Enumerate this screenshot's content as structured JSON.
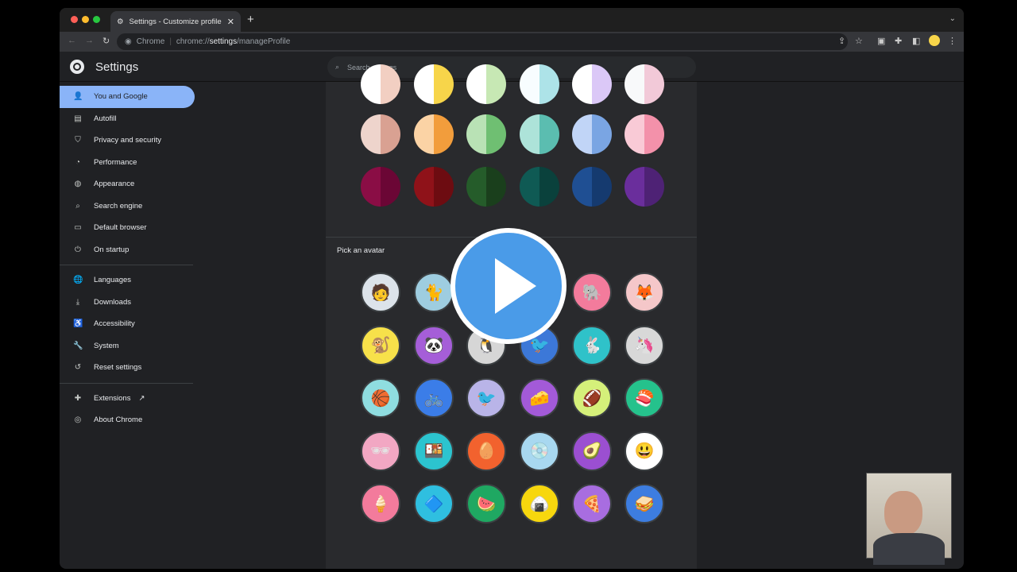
{
  "browser": {
    "tab_title": "Settings - Customize profile",
    "omnibox_site": "Chrome",
    "url_prefix": "chrome://",
    "url_host": "settings",
    "url_path": "/manageProfile"
  },
  "header": {
    "title": "Settings",
    "search_placeholder": "Search settings"
  },
  "sidebar": {
    "items": [
      {
        "label": "You and Google",
        "icon": "person-icon",
        "glyph": "👤"
      },
      {
        "label": "Autofill",
        "icon": "clipboard-icon",
        "glyph": "▤"
      },
      {
        "label": "Privacy and security",
        "icon": "shield-icon",
        "glyph": "⛉"
      },
      {
        "label": "Performance",
        "icon": "speedometer-icon",
        "glyph": "◔"
      },
      {
        "label": "Appearance",
        "icon": "palette-icon",
        "glyph": "◍"
      },
      {
        "label": "Search engine",
        "icon": "search-icon",
        "glyph": "⌕"
      },
      {
        "label": "Default browser",
        "icon": "browser-icon",
        "glyph": "▭"
      },
      {
        "label": "On startup",
        "icon": "power-icon",
        "glyph": "⏻"
      },
      {
        "label": "Languages",
        "icon": "globe-icon",
        "glyph": "🌐"
      },
      {
        "label": "Downloads",
        "icon": "download-icon",
        "glyph": "⤓"
      },
      {
        "label": "Accessibility",
        "icon": "accessibility-icon",
        "glyph": "♿"
      },
      {
        "label": "System",
        "icon": "wrench-icon",
        "glyph": "🔧"
      },
      {
        "label": "Reset settings",
        "icon": "history-icon",
        "glyph": "↺"
      },
      {
        "label": "Extensions",
        "icon": "puzzle-icon",
        "glyph": "✚"
      },
      {
        "label": "About Chrome",
        "icon": "chrome-icon",
        "glyph": "◎"
      }
    ]
  },
  "main": {
    "pick_avatar_label": "Pick an avatar",
    "colors": [
      [
        "#ffffff",
        "#f2cfc2"
      ],
      [
        "#ffffff",
        "#f7d54a"
      ],
      [
        "#ffffff",
        "#c7e8b4"
      ],
      [
        "#f8fdff",
        "#ade3e8"
      ],
      [
        "#ffffff",
        "#dbc8f7"
      ],
      [
        "#f8f9fa",
        "#f2c9d8"
      ],
      [
        "#eed4cc",
        "#d9a192"
      ],
      [
        "#fbd3a5",
        "#f29d3c"
      ],
      [
        "#b9e2b5",
        "#6fbf72"
      ],
      [
        "#ade3d9",
        "#5bbdb0"
      ],
      [
        "#c1d5f7",
        "#7aa5e3"
      ],
      [
        "#f9cad6",
        "#f391aa"
      ],
      [
        "#8a0d45",
        "#6b0635"
      ],
      [
        "#8f1219",
        "#6d0c11"
      ],
      [
        "#255c2a",
        "#1a3f1c"
      ],
      [
        "#0f5a54",
        "#0a413c"
      ],
      [
        "#1f4f93",
        "#153a6f"
      ],
      [
        "#6a2e9c",
        "#4e2275"
      ]
    ],
    "avatars": [
      {
        "name": "profile-photo",
        "bg": "#dce3ea",
        "glyph": "🧑"
      },
      {
        "name": "cat",
        "bg": "#9ecde0",
        "glyph": "🐈"
      },
      {
        "name": "hidden-1",
        "bg": "#ffffff",
        "glyph": ""
      },
      {
        "name": "hidden-2",
        "bg": "#ffffff",
        "glyph": ""
      },
      {
        "name": "elephant",
        "bg": "#f37b9c",
        "glyph": "🐘"
      },
      {
        "name": "fox",
        "bg": "#f5c7c9",
        "glyph": "🦊"
      },
      {
        "name": "monkey",
        "bg": "#f7e14a",
        "glyph": "🐒"
      },
      {
        "name": "panda",
        "bg": "#a55ed8",
        "glyph": "🐼"
      },
      {
        "name": "penguin",
        "bg": "#d6d6d6",
        "glyph": "🐧"
      },
      {
        "name": "bird",
        "bg": "#3c78d8",
        "glyph": "🐦"
      },
      {
        "name": "rabbit",
        "bg": "#2fc2c9",
        "glyph": "🐇"
      },
      {
        "name": "unicorn",
        "bg": "#d8d8d8",
        "glyph": "🦄"
      },
      {
        "name": "basketball",
        "bg": "#8fdde0",
        "glyph": "🏀"
      },
      {
        "name": "bike",
        "bg": "#3b7de8",
        "glyph": "🚲"
      },
      {
        "name": "cardinal",
        "bg": "#b9b4e8",
        "glyph": "🐦"
      },
      {
        "name": "cheese",
        "bg": "#a35ad8",
        "glyph": "🧀"
      },
      {
        "name": "football",
        "bg": "#d5f07a",
        "glyph": "🏈"
      },
      {
        "name": "sushi-plate",
        "bg": "#25c28c",
        "glyph": "🍣"
      },
      {
        "name": "sunglasses",
        "bg": "#f2a7c3",
        "glyph": "🕶"
      },
      {
        "name": "sushi",
        "bg": "#2cc4cf",
        "glyph": "🍱"
      },
      {
        "name": "tamagotchi",
        "bg": "#f2622e",
        "glyph": "🥚"
      },
      {
        "name": "vinyl",
        "bg": "#a8d8f0",
        "glyph": "💿"
      },
      {
        "name": "avocado",
        "bg": "#9b4fd1",
        "glyph": "🥑"
      },
      {
        "name": "smiley",
        "bg": "#ffffff",
        "glyph": "😃"
      },
      {
        "name": "ice-cream",
        "bg": "#f37b9c",
        "glyph": "🍦"
      },
      {
        "name": "diamond",
        "bg": "#2fbfe0",
        "glyph": "🔷"
      },
      {
        "name": "watermelon",
        "bg": "#1fa862",
        "glyph": "🍉"
      },
      {
        "name": "onigiri",
        "bg": "#f7d70e",
        "glyph": "🍙"
      },
      {
        "name": "pizza",
        "bg": "#a86de0",
        "glyph": "🍕"
      },
      {
        "name": "sandwich",
        "bg": "#3d7de0",
        "glyph": "🥪"
      }
    ]
  }
}
